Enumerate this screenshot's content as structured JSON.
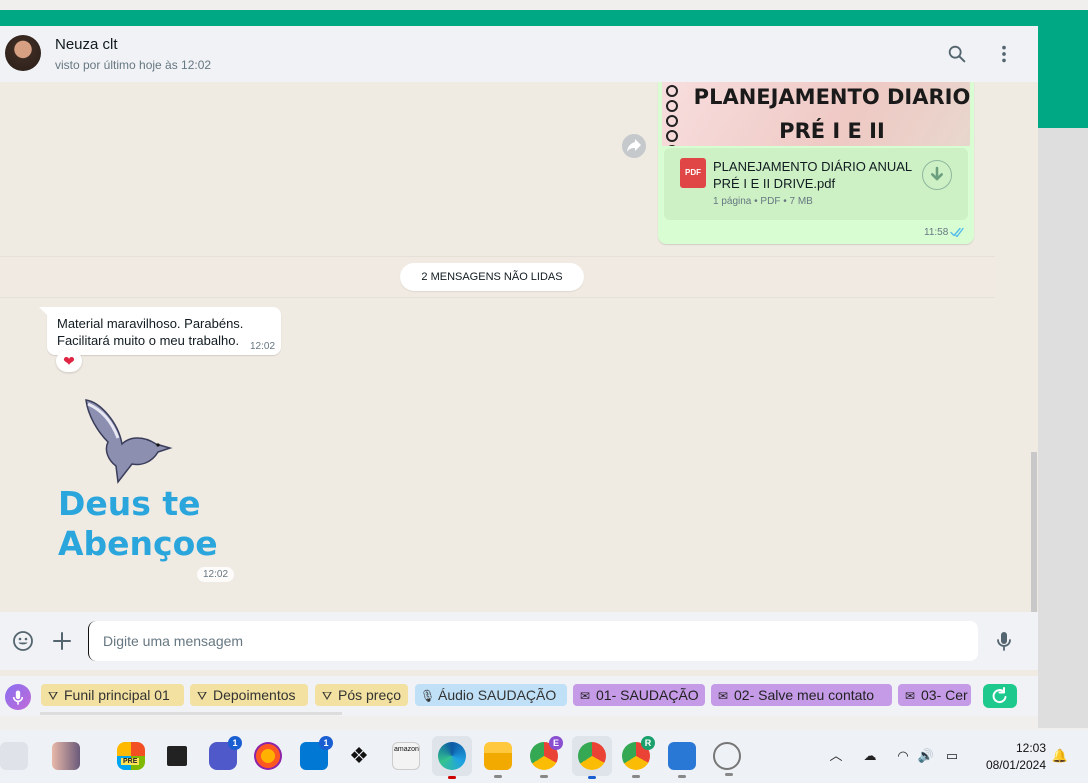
{
  "header": {
    "contact_name": "Neuza clt",
    "status": "visto por último hoje às 12:02"
  },
  "chat": {
    "pdf_message": {
      "thumbnail_title_line1": "PLANEJAMENTO DIARIO",
      "thumbnail_title_line2": "PRÉ I E II",
      "file_icon_label": "PDF",
      "file_name": "PLANEJAMENTO DIÁRIO ANUAL PRÉ I E II DRIVE.pdf",
      "file_meta": "1 página • PDF • 7 MB",
      "time": "11:58"
    },
    "unread_divider": "2 MENSAGENS NÃO LIDAS",
    "incoming_message": {
      "line1": "Material maravilhoso. Parabéns.",
      "line2": "Facilitará muito o meu trabalho.",
      "time": "12:02",
      "reaction": "❤"
    },
    "sticker": {
      "line1": "Deus te",
      "line2": "Abençoe",
      "time": "12:02"
    }
  },
  "composer": {
    "placeholder": "Digite uma mensagem"
  },
  "quick_replies": [
    {
      "label": "Funil principal 01",
      "kind": "funnel"
    },
    {
      "label": "Depoimentos",
      "kind": "funnel"
    },
    {
      "label": "Pós preço",
      "kind": "funnel"
    },
    {
      "label": "Áudio SAUDAÇÃO",
      "kind": "audio"
    },
    {
      "label": "01- SAUDAÇÃO",
      "kind": "message"
    },
    {
      "label": "02- Salve meu contato",
      "kind": "message"
    },
    {
      "label": "03- Cer",
      "kind": "message"
    }
  ],
  "taskbar": {
    "badges": {
      "meet": "1",
      "store": "1",
      "chrome_e": "E",
      "chrome_r": "R"
    },
    "pre_label": "PRE",
    "amazon_label": "amazon",
    "time": "12:03",
    "date": "08/01/2024"
  },
  "colors": {
    "accent": "#00a884",
    "outgoing_bubble": "#d9fdd3",
    "chat_bg": "#efeae2",
    "read_ticks": "#53bdeb",
    "chip_yellow": "#f2e1a0",
    "chip_blue": "#bfe0f7",
    "chip_purple": "#c59be8"
  }
}
